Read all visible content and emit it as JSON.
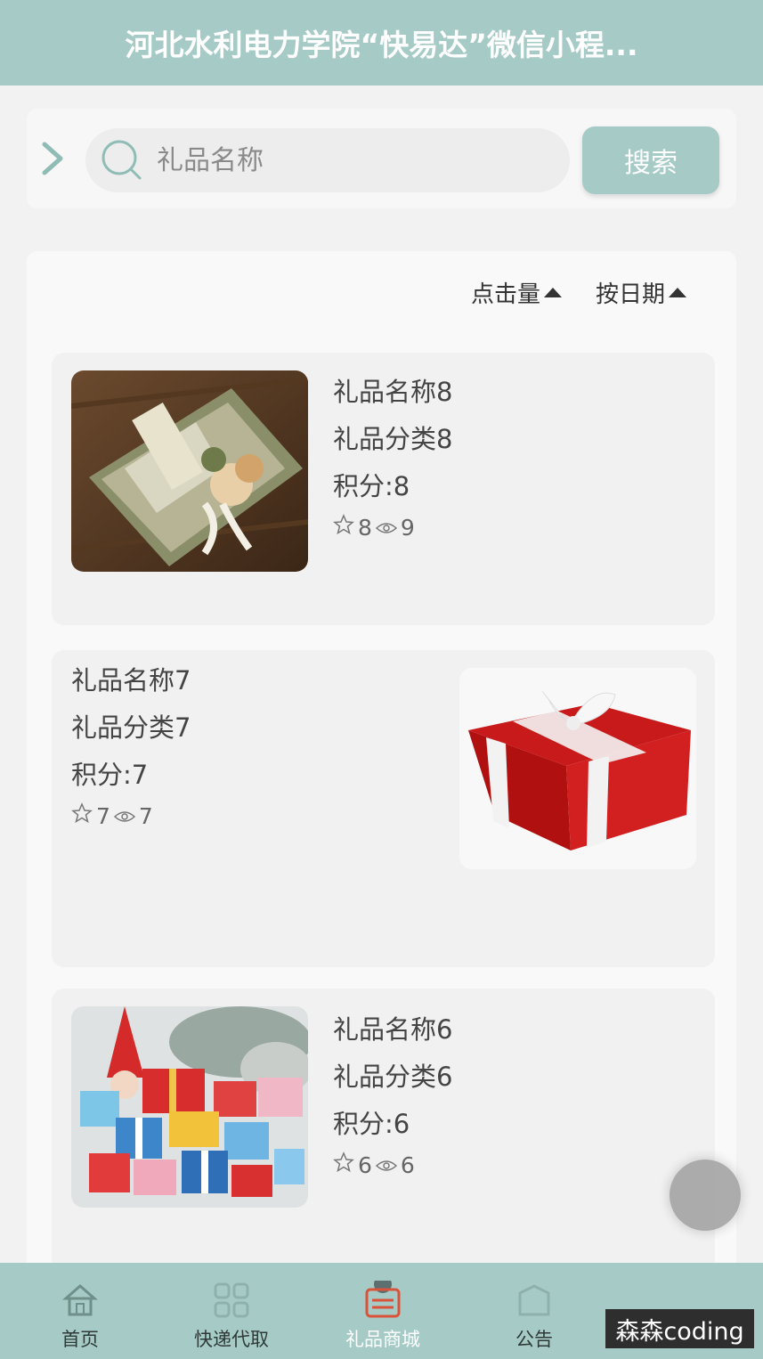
{
  "header": {
    "title": "河北水利电力学院“快易达”微信小程..."
  },
  "search": {
    "placeholder": "礼品名称",
    "button_label": "搜索"
  },
  "sort": {
    "clicks_label": "点击量",
    "date_label": "按日期"
  },
  "gifts": [
    {
      "name": "礼品名称8",
      "category": "礼品分类8",
      "points": "积分:8",
      "likes": "8",
      "views": "9",
      "image": "gift-box-flowers-photo"
    },
    {
      "name": "礼品名称7",
      "category": "礼品分类7",
      "points": "积分:7",
      "likes": "7",
      "views": "7",
      "image": "red-gift-box-photo"
    },
    {
      "name": "礼品名称6",
      "category": "礼品分类6",
      "points": "积分:6",
      "likes": "6",
      "views": "6",
      "image": "christmas-gifts-photo"
    }
  ],
  "tabbar": {
    "items": [
      {
        "label": "首页",
        "icon": "home-icon",
        "active": false
      },
      {
        "label": "快递代取",
        "icon": "grid-icon",
        "active": false
      },
      {
        "label": "礼品商城",
        "icon": "shop-icon",
        "active": true
      },
      {
        "label": "公告",
        "icon": "notice-icon",
        "active": false
      }
    ]
  },
  "watermark": "森森coding",
  "colors": {
    "accent": "#a6cbc6",
    "background": "#f2f2f3"
  }
}
